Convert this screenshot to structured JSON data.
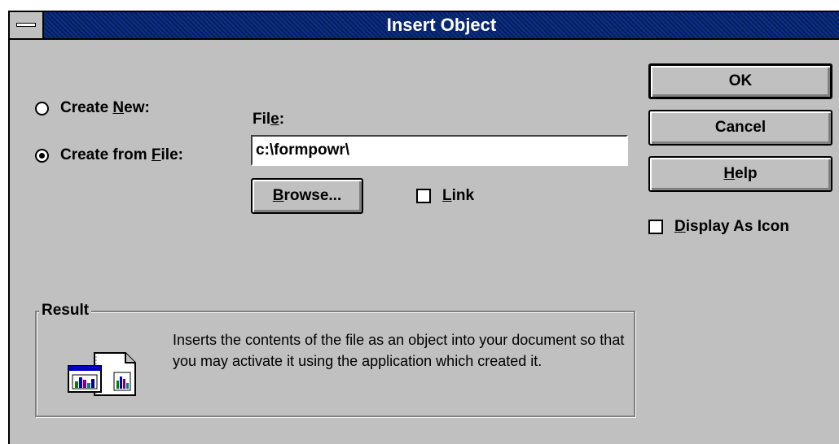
{
  "window": {
    "title": "Insert Object"
  },
  "options": {
    "create_new": {
      "prefix": "Create ",
      "hotkey": "N",
      "suffix": "ew:",
      "selected": false
    },
    "create_from_file": {
      "prefix": "Create from ",
      "hotkey": "F",
      "suffix": "ile:",
      "selected": true
    }
  },
  "file": {
    "label_prefix": "Fil",
    "label_hotkey": "e",
    "label_suffix": ":",
    "value": "c:\\formpowr\\"
  },
  "buttons": {
    "ok": "OK",
    "cancel": "Cancel",
    "help_hotkey": "H",
    "help_rest": "elp",
    "browse_hotkey": "B",
    "browse_rest": "rowse..."
  },
  "link": {
    "hotkey": "L",
    "rest": "ink",
    "checked": false
  },
  "display_as_icon": {
    "hotkey": "D",
    "rest": "isplay As Icon",
    "checked": false
  },
  "result": {
    "label": "Result",
    "text": "Inserts the contents of the file as an object into your document so that you may activate it using the application which created it.",
    "icon": "insert-file-object-icon"
  },
  "colors": {
    "title_bar": "#0a2a7a",
    "dialog_bg": "#c0c0c0"
  }
}
